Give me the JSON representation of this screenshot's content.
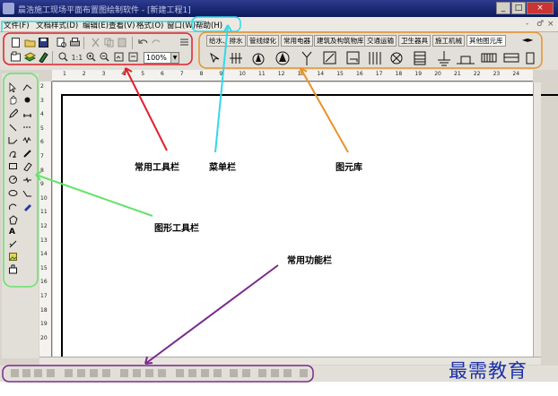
{
  "window": {
    "title": "晨浩施工现场平面布置图绘制软件 - [新建工程1]",
    "controls": [
      "_",
      "□",
      "×"
    ]
  },
  "menubar": {
    "items": [
      "文件(F)",
      "文档样式(D)",
      "编辑(E)",
      "查看(V)",
      "格式(O)",
      "窗口(W)",
      "帮助(H)"
    ],
    "right_controls": [
      "- ",
      "♂",
      "×"
    ]
  },
  "toolbar": {
    "zoom": "100%"
  },
  "library": {
    "tabs": [
      "给水、排水",
      "管线绿化",
      "常用电器",
      "建筑及构筑物库",
      "交通运输",
      "卫生器具",
      "施工机械",
      "其他图元库"
    ],
    "active_tab": "其他图元库"
  },
  "ruler": {
    "top": [
      "1",
      "2",
      "3",
      "4",
      "5",
      "6",
      "7",
      "8",
      "9",
      "10",
      "11",
      "12",
      "13",
      "14",
      "15",
      "16",
      "17",
      "18",
      "19",
      "20",
      "21",
      "22",
      "23",
      "24"
    ],
    "left": [
      "2",
      "3",
      "4",
      "5",
      "6",
      "7",
      "8",
      "9",
      "10",
      "11",
      "12",
      "13",
      "14",
      "15",
      "16",
      "17",
      "18",
      "19",
      "20"
    ]
  },
  "palette": {
    "text_tool": "A"
  },
  "annotations": {
    "common_toolbar": "常用工具栏",
    "menubar": "菜单栏",
    "library": "图元库",
    "shape_toolbar": "图形工具栏",
    "function_bar": "常用功能栏"
  },
  "watermark": "最需教育",
  "colors": {
    "red": "#e0202a",
    "cyan": "#35d8e6",
    "orange": "#e8922a",
    "green": "#66e26a",
    "purple": "#7a2a8e",
    "title_bar": "#1a276e"
  }
}
